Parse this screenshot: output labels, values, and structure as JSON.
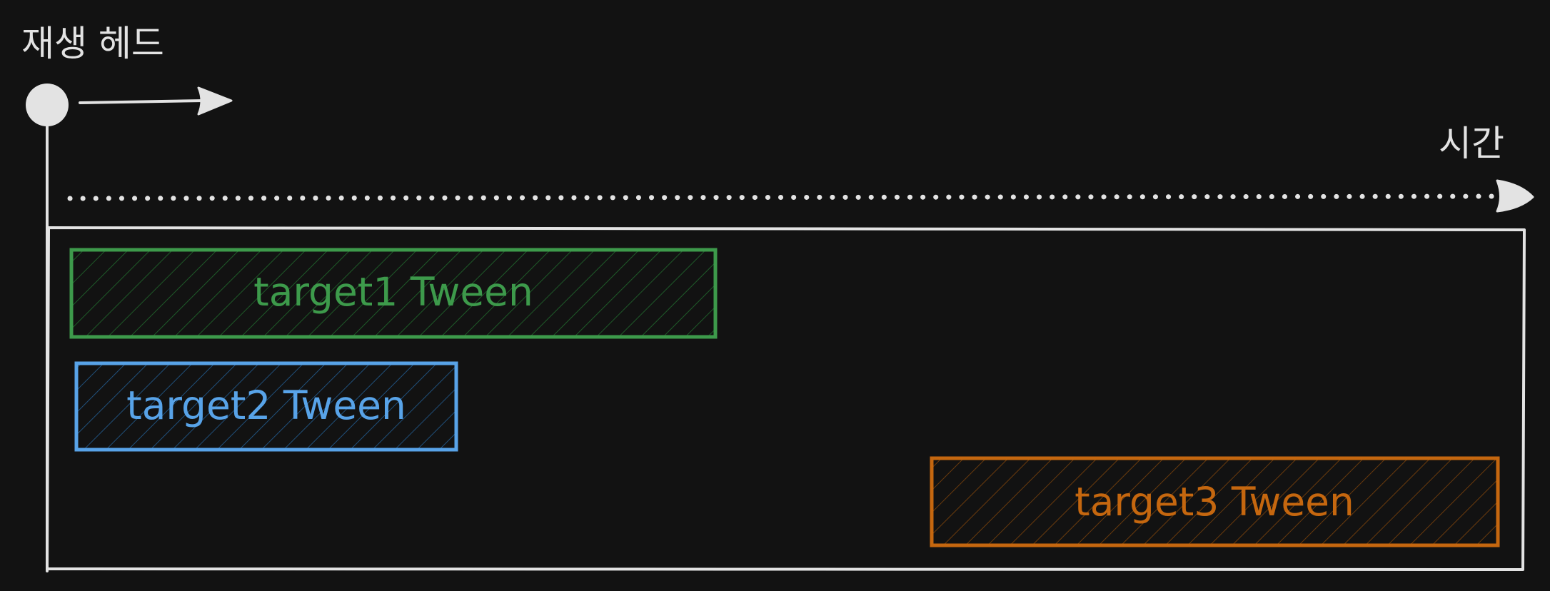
{
  "playhead": {
    "label": "재생 헤드",
    "color": "#e3e3e3"
  },
  "time_axis": {
    "label": "시간",
    "color": "#e3e3e3"
  },
  "timeline_frame": {
    "color": "#e3e3e3"
  },
  "tweens": [
    {
      "label": "target1 Tween",
      "stroke": "#3d9a4b",
      "hatch": "#1e5a28",
      "text": "#3d9a4b"
    },
    {
      "label": "target2 Tween",
      "stroke": "#58a3e8",
      "hatch": "#1f4f7a",
      "text": "#58a3e8"
    },
    {
      "label": "target3 Tween",
      "stroke": "#c5670f",
      "hatch": "#6a3a0c",
      "text": "#c5670f"
    }
  ]
}
